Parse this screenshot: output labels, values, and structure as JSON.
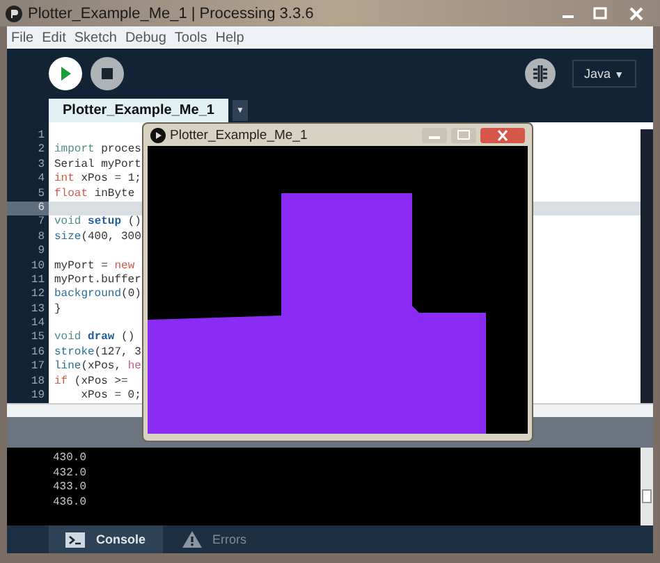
{
  "window": {
    "title": "Plotter_Example_Me_1 | Processing 3.3.6"
  },
  "menu": [
    "File",
    "Edit",
    "Sketch",
    "Debug",
    "Tools",
    "Help"
  ],
  "toolbar": {
    "mode": "Java",
    "mode_arrow": "▼"
  },
  "tabs": [
    {
      "label": "Plotter_Example_Me_1",
      "selected": true
    }
  ],
  "tab_menu_arrow": "▼",
  "editor": {
    "lines": [
      {
        "number": "1",
        "highlighted": false
      },
      {
        "number": "2",
        "highlighted": false,
        "tokens": [
          {
            "text": "import",
            "kind": "keyword"
          },
          {
            "text": " proces",
            "kind": "plain"
          }
        ]
      },
      {
        "number": "3",
        "highlighted": false,
        "tokens": [
          {
            "text": "Serial myPort",
            "kind": "plain"
          }
        ]
      },
      {
        "number": "4",
        "highlighted": false,
        "tokens": [
          {
            "text": "int",
            "kind": "type"
          },
          {
            "text": " xPos = 1;",
            "kind": "plain"
          }
        ]
      },
      {
        "number": "5",
        "highlighted": false,
        "tokens": [
          {
            "text": "float",
            "kind": "type"
          },
          {
            "text": " inByte",
            "kind": "plain"
          }
        ]
      },
      {
        "number": "6",
        "highlighted": true
      },
      {
        "number": "7",
        "highlighted": false,
        "tokens": [
          {
            "text": "void ",
            "kind": "keyword"
          },
          {
            "text": "setup",
            "kind": "method"
          },
          {
            "text": " ()",
            "kind": "plain"
          }
        ]
      },
      {
        "number": "8",
        "highlighted": false,
        "tokens": [
          {
            "text": "size",
            "kind": "function"
          },
          {
            "text": "(400, 300",
            "kind": "plain"
          }
        ]
      },
      {
        "number": "9",
        "highlighted": false
      },
      {
        "number": "10",
        "highlighted": false,
        "tokens": [
          {
            "text": "myPort = ",
            "kind": "plain"
          },
          {
            "text": "new",
            "kind": "type"
          }
        ]
      },
      {
        "number": "11",
        "highlighted": false,
        "tokens": [
          {
            "text": "myPort.buffer",
            "kind": "plain"
          }
        ]
      },
      {
        "number": "12",
        "highlighted": false,
        "tokens": [
          {
            "text": "background",
            "kind": "function"
          },
          {
            "text": "(0)",
            "kind": "plain"
          }
        ]
      },
      {
        "number": "13",
        "highlighted": false,
        "tokens": [
          {
            "text": "}",
            "kind": "plain"
          }
        ]
      },
      {
        "number": "14",
        "highlighted": false
      },
      {
        "number": "15",
        "highlighted": false,
        "tokens": [
          {
            "text": "void ",
            "kind": "keyword"
          },
          {
            "text": "draw",
            "kind": "method"
          },
          {
            "text": " ()",
            "kind": "plain"
          }
        ]
      },
      {
        "number": "16",
        "highlighted": false,
        "tokens": [
          {
            "text": "stroke",
            "kind": "function"
          },
          {
            "text": "(127, 3",
            "kind": "plain"
          }
        ]
      },
      {
        "number": "17",
        "highlighted": false,
        "tokens": [
          {
            "text": "line",
            "kind": "function"
          },
          {
            "text": "(xPos, ",
            "kind": "plain"
          },
          {
            "text": "he",
            "kind": "builtin"
          }
        ]
      },
      {
        "number": "18",
        "highlighted": false,
        "tokens": [
          {
            "text": "if",
            "kind": "type"
          },
          {
            "text": " (xPos >=",
            "kind": "plain"
          }
        ]
      },
      {
        "number": "19",
        "highlighted": false,
        "tokens": [
          {
            "text": "    xPos = 0;",
            "kind": "plain"
          }
        ]
      }
    ]
  },
  "sketch_window": {
    "title": "Plotter_Example_Me_1"
  },
  "console": {
    "lines": [
      "430.0",
      "432.0",
      "433.0",
      "436.0"
    ]
  },
  "console_tabs": [
    {
      "label": "Console",
      "selected": true,
      "kind": "console"
    },
    {
      "label": "Errors",
      "selected": false,
      "kind": "errors"
    }
  ]
}
